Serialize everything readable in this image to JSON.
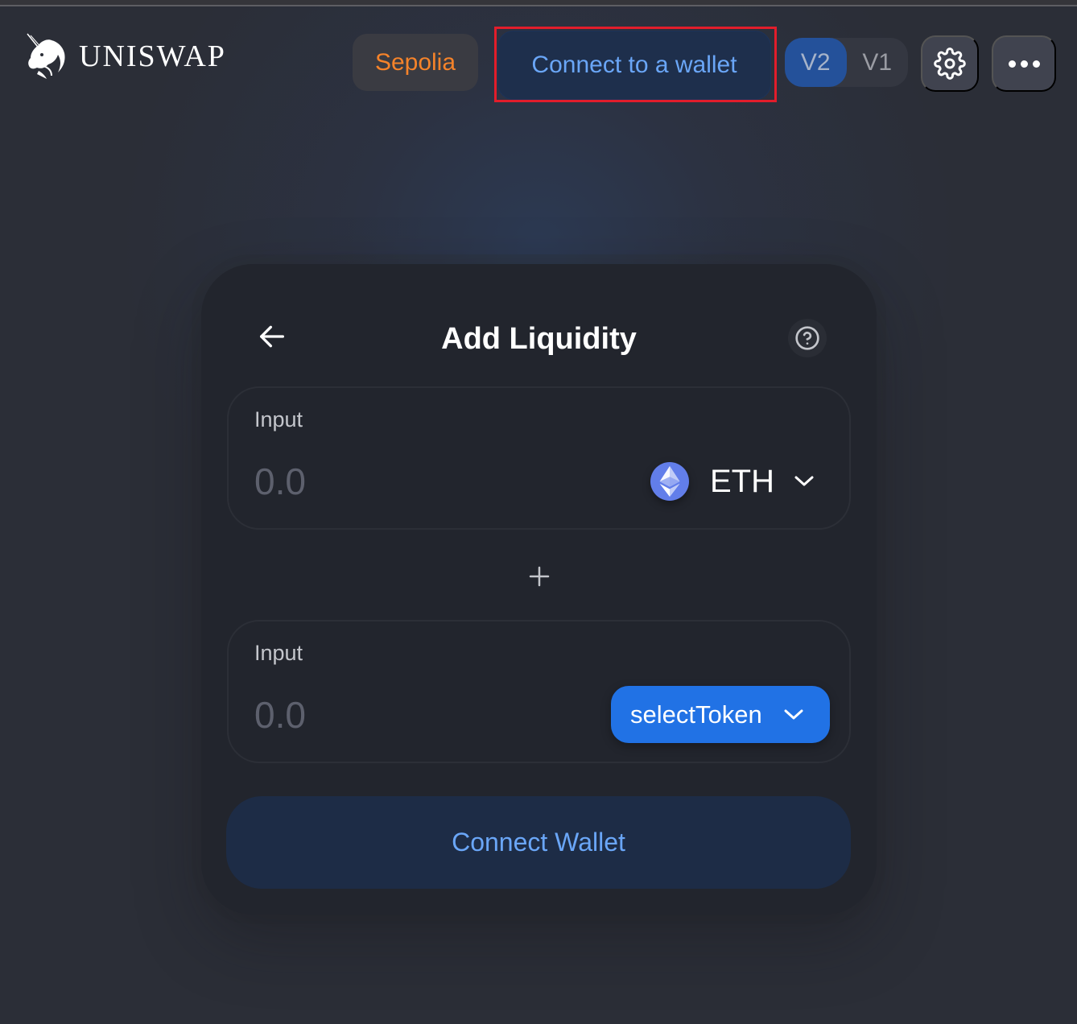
{
  "header": {
    "logo_text": "UNISWAP",
    "network_label": "Sepolia",
    "connect_label": "Connect to a wallet",
    "versions": [
      {
        "label": "V2",
        "active": true
      },
      {
        "label": "V1",
        "active": false
      }
    ],
    "settings_icon": "gear-icon",
    "more_icon": "more-horizontal-icon"
  },
  "card": {
    "title": "Add Liquidity",
    "back_icon": "arrow-left-icon",
    "help_icon": "question-circle-icon",
    "panels": [
      {
        "label": "Input",
        "amount_placeholder": "0.0",
        "token_symbol": "ETH",
        "token_icon": "ethereum-icon"
      },
      {
        "label": "Input",
        "amount_placeholder": "0.0",
        "select_label": "selectToken"
      }
    ],
    "plus_icon": "plus-icon",
    "connect_wallet_label": "Connect Wallet"
  },
  "colors": {
    "network_accent": "#f5832a",
    "link_blue": "#6aa6f7",
    "primary_blue": "#2172e5",
    "eth_blue": "#627eea",
    "highlight_red": "#e21d2b"
  }
}
